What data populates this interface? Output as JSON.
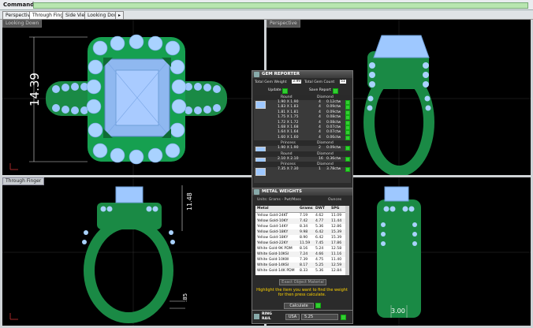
{
  "command": {
    "label": "Command:"
  },
  "tabs": [
    "Perspective",
    "Through Finger",
    "Side View",
    "Looking Down",
    "▸"
  ],
  "viewports": {
    "top_left": {
      "label": "Looking Down"
    },
    "top_right": {
      "label": "Perspective"
    },
    "bottom_left": {
      "label": "Through Finger"
    },
    "bottom_right": {
      "label": ""
    }
  },
  "dimensions": {
    "height_main": "14.39",
    "height_side": "11.48",
    "shank": ".85",
    "width_bottom": "3.00"
  },
  "gem_reporter": {
    "title": "GEM REPORTER",
    "total_weight_label": "Total Gem Weight",
    "total_weight_value": "3.99",
    "total_count_label": "Total Gem Count",
    "total_count_value": "51",
    "update_label": "Update",
    "save_label": "Save Report",
    "groups": [
      {
        "shape": "Round",
        "type": "Diamond",
        "rows": [
          [
            "1.90 X 1.90",
            "4",
            "0.12ctw"
          ],
          [
            "1.83 X 1.83",
            "4",
            "0.09ctw"
          ],
          [
            "1.81 X 1.81",
            "4",
            "0.09ctw"
          ],
          [
            "1.75 X 1.75",
            "4",
            "0.08ctw"
          ],
          [
            "1.72 X 1.72",
            "4",
            "0.08ctw"
          ],
          [
            "1.68 X 1.68",
            "4",
            "0.07ctw"
          ],
          [
            "1.64 X 1.64",
            "4",
            "0.07ctw"
          ],
          [
            "1.60 X 1.60",
            "4",
            "0.06ctw"
          ]
        ]
      },
      {
        "shape": "Princess",
        "type": "Diamond",
        "rows": [
          [
            "1.90 X 1.90",
            "2",
            "0.09ctw"
          ]
        ]
      },
      {
        "shape": "Round",
        "type": "Diamond",
        "rows": [
          [
            "2.10 X 2.10",
            "16",
            "0.36ctw"
          ]
        ]
      },
      {
        "shape": "Princess",
        "type": "Diamond",
        "rows": [
          [
            "7.35 X 7.30",
            "1",
            "3.78ctw"
          ]
        ]
      }
    ]
  },
  "metal_weights": {
    "title": "METAL WEIGHTS",
    "tabs": [
      "Units: Grams - Pwt/Mass",
      "Ounces"
    ],
    "headers": [
      "Metal",
      "Grams",
      "DWT",
      "SPG"
    ],
    "rows": [
      [
        "Yellow Gold-24KT",
        "7.19",
        "4.62",
        "11.09"
      ],
      [
        "Yellow Gold-10KY",
        "7.42",
        "4.77",
        "11.44"
      ],
      [
        "Yellow Gold-14KY",
        "8.34",
        "5.36",
        "12.86"
      ],
      [
        "Yellow Gold-18KY",
        "9.98",
        "6.42",
        "15.39"
      ],
      [
        "Yellow Gold-18KY",
        "8.90",
        "6.42",
        "15.39"
      ],
      [
        "Yellow Gold-22KY",
        "11.59",
        "7.45",
        "17.86"
      ],
      [
        "White Gold-9K PDM",
        "8.16",
        "5.24",
        "12.58"
      ],
      [
        "White Gold-10KSI",
        "7.24",
        "4.66",
        "11.16"
      ],
      [
        "White Gold-10KW",
        "7.39",
        "4.75",
        "11.40"
      ],
      [
        "White Gold-14KSI",
        "8.17",
        "5.25",
        "12.59"
      ],
      [
        "White Gold-14K PDM",
        "8.33",
        "5.36",
        "12.84"
      ]
    ],
    "select_label": "Exact Object Material",
    "hint": "Highlight the item you want to find the weight for then press calculate.",
    "calculate_label": "Calculate"
  },
  "ring_rail": {
    "label": "RING RAIL",
    "size_system": "USA",
    "size_value": "5.25"
  },
  "colors": {
    "metal": "#1a8a45",
    "gem": "#9ec8ff",
    "panel_bg": "#2b2b2b",
    "grid": "#4a4a4a"
  }
}
